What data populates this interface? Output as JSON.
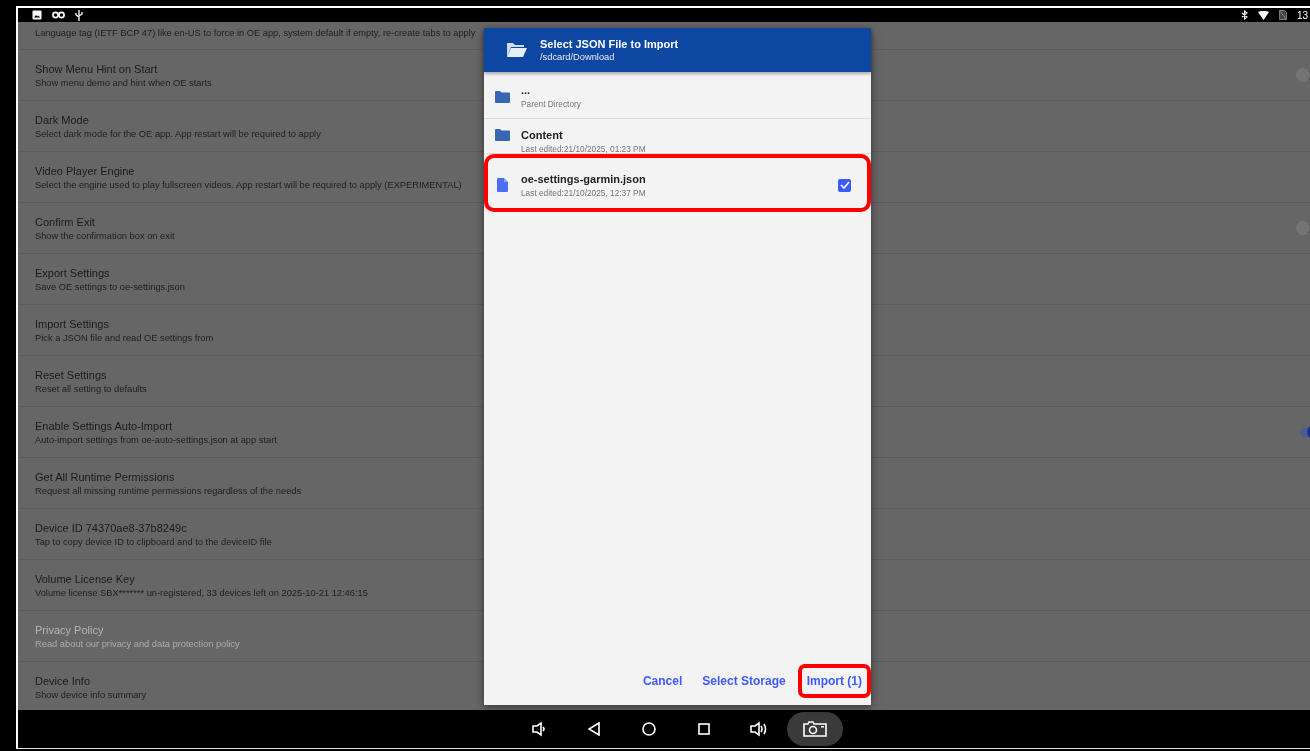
{
  "status_bar": {
    "time": "13"
  },
  "settings": {
    "items": [
      {
        "subtitle": "Language tag (IETF BCP 47) like en-US to force in OE app, system default if empty, re-create tabs to apply",
        "kind": "plain",
        "disabled": false
      },
      {
        "title": "Show Menu Hint on Start",
        "subtitle": "Show menu demo and hint when OE starts",
        "kind": "toggle",
        "on": false,
        "disabled": false
      },
      {
        "title": "Dark Mode",
        "subtitle": "Select dark mode for the OE app. App restart will be required to apply",
        "kind": "plain",
        "disabled": false
      },
      {
        "title": "Video Player Engine",
        "subtitle": "Select the engine used to play fullscreen videos. App restart will be required to apply (EXPERIMENTAL)",
        "kind": "plain",
        "disabled": false
      },
      {
        "title": "Confirm Exit",
        "subtitle": "Show the confirmation box on exit",
        "kind": "toggle",
        "on": false,
        "disabled": false
      },
      {
        "title": "Export Settings",
        "subtitle": "Save OE settings to oe-settings.json",
        "kind": "plain",
        "disabled": false
      },
      {
        "title": "Import Settings",
        "subtitle": "Pick a JSON file and read OE settings from",
        "kind": "plain",
        "disabled": false
      },
      {
        "title": "Reset Settings",
        "subtitle": "Reset all setting to defaults",
        "kind": "plain",
        "disabled": false
      },
      {
        "title": "Enable Settings Auto-Import",
        "subtitle": "Auto-import settings from oe-auto-settings.json at app start",
        "kind": "toggle",
        "on": true,
        "disabled": false
      },
      {
        "title": "Get All Runtime Permissions",
        "subtitle": "Request all missing runtime permissions regardless of the needs",
        "kind": "plain",
        "disabled": false
      },
      {
        "title": "Device ID 74370ae8-37b8249c",
        "subtitle": "Tap to copy device ID to clipboard and to the deviceID file",
        "kind": "plain",
        "disabled": false
      },
      {
        "title": "Volume License Key",
        "subtitle": "Volume license SBX******* un-registered, 33 devices left on 2025-10-21 12:46:15",
        "kind": "plain",
        "disabled": false
      },
      {
        "title": "Privacy Policy",
        "subtitle": "Read about our privacy and data protection policy",
        "kind": "plain",
        "disabled": true
      },
      {
        "title": "Device Info",
        "subtitle": "Show device info summary",
        "kind": "plain",
        "disabled": false
      }
    ]
  },
  "dialog": {
    "title": "Select JSON File to Import",
    "path": "/sdcard/Download",
    "items": [
      {
        "kind": "folder",
        "name": "...",
        "detail": "Parent Directory",
        "checked": false,
        "highlighted": false
      },
      {
        "kind": "folder",
        "name": "Content",
        "detail": "Last edited:21/10/2025, 01:23 PM",
        "checked": false,
        "highlighted": false
      },
      {
        "kind": "file",
        "name": "oe-settings-garmin.json",
        "detail": "Last edited:21/10/2025, 12:37 PM",
        "checked": true,
        "highlighted": true
      }
    ],
    "buttons": [
      {
        "label": "Cancel",
        "highlighted": false
      },
      {
        "label": "Select Storage",
        "highlighted": false
      },
      {
        "label": "Import (1)",
        "highlighted": true
      }
    ]
  }
}
